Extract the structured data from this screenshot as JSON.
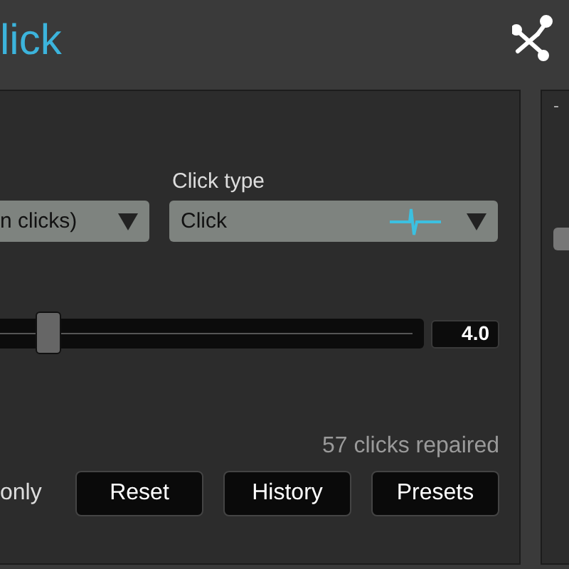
{
  "title": "lick",
  "side_panel": {
    "scale_label": "-"
  },
  "mode_dropdown": {
    "value": "n clicks)"
  },
  "click_type": {
    "label": "Click type",
    "value": "Click"
  },
  "sensitivity": {
    "level": 0.09,
    "reading": "4.0"
  },
  "status": "57 clicks repaired",
  "option_label": "only",
  "buttons": [
    "Reset",
    "History",
    "Presets"
  ]
}
